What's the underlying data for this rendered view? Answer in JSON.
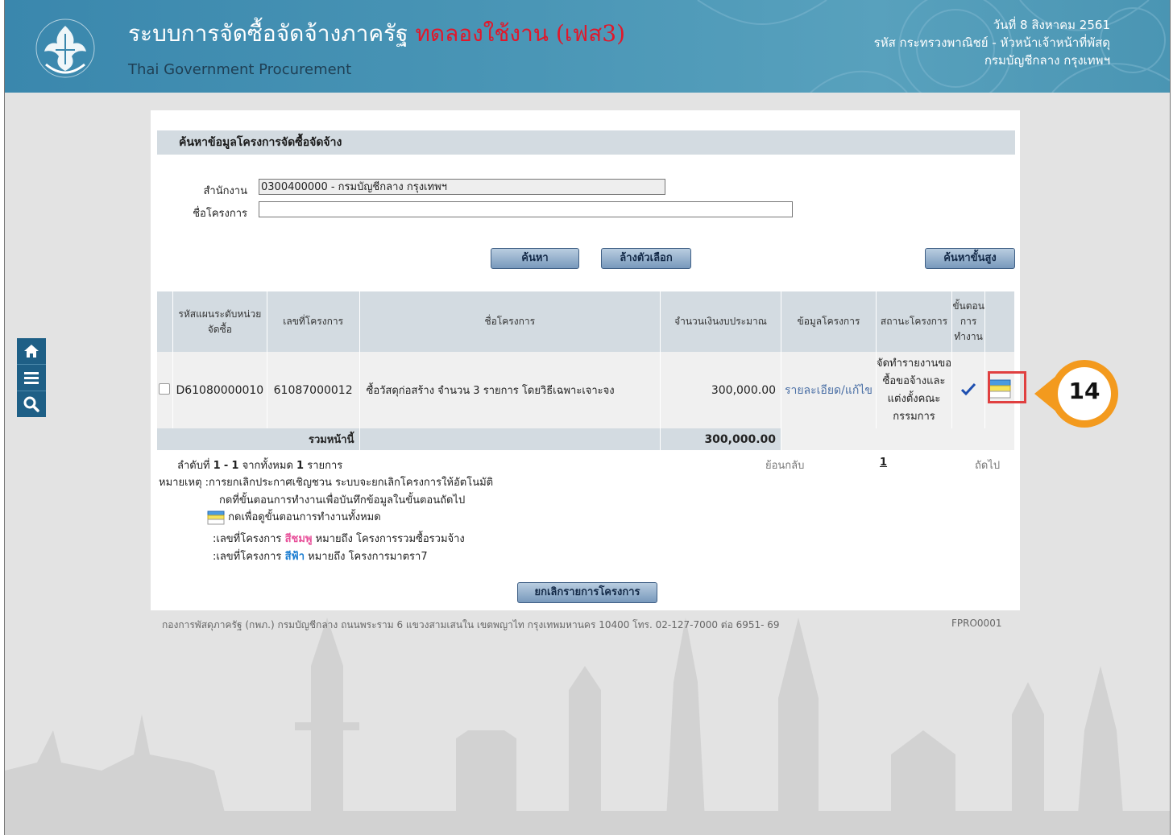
{
  "header": {
    "title": "ระบบการจัดซื้อจัดจ้างภาครัฐ",
    "title_trial": "ทดลองใช้งาน (เฟส3)",
    "subtitle": "Thai Government Procurement",
    "date": "วันที่ 8 สิงหาคม 2561",
    "user_line": "รหัส กระทรวงพาณิชย์ - หัวหน้าเจ้าหน้าที่พัสดุ",
    "org_line": "กรมบัญชีกลาง กรุงเทพฯ",
    "logo_text": "กรมบัญชีกลาง"
  },
  "side_tools": [
    "home-icon",
    "menu-icon",
    "search-icon"
  ],
  "search": {
    "section_title": "ค้นหาข้อมูลโครงการจัดซื้อจัดจ้าง",
    "office_label": "สำนักงาน",
    "office_value": "0300400000 - กรมบัญชีกลาง กรุงเทพฯ",
    "project_name_label": "ชื่อโครงการ",
    "project_name_value": "",
    "search_button": "ค้นหา",
    "clear_button": "ล้างตัวเลือก",
    "advanced_button": "ค้นหาขั้นสูง"
  },
  "table": {
    "headers": {
      "plan_code": "รหัสแผนระดับหน่วยจัดซื้อ",
      "project_no": "เลขที่โครงการ",
      "project_name": "ชื่อโครงการ",
      "budget": "จำนวนเงินงบประมาณ",
      "project_info": "ข้อมูลโครงการ",
      "status": "สถานะโครงการ",
      "step": "ขั้นตอนการทำงาน"
    },
    "rows": [
      {
        "plan_code": "D61080000010",
        "project_no": "61087000012",
        "project_name": "ซื้อวัสดุก่อสร้าง จำนวน 3 รายการ โดยวิธีเฉพาะเจาะจง",
        "budget": "300,000.00",
        "detail_link": "รายละเอียด/แก้ไข",
        "status": "จัดทำรายงานขอซื้อขอจ้างและแต่งตั้งคณะกรรมการ"
      }
    ],
    "sum_label": "รวมหน้านี้",
    "sum_value": "300,000.00"
  },
  "pagination": {
    "summary_prefix": "ลำดับที่",
    "range_from": "1",
    "range_sep": "-",
    "range_to": "1",
    "summary_mid": "จากทั้งหมด",
    "total": "1",
    "summary_suffix": "รายการ",
    "prev": "ย้อนกลับ",
    "page": "1",
    "next": "ถัดไป"
  },
  "notes": {
    "line1": "หมายเหตุ :การยกเลิกประกาศเชิญชวน ระบบจะยกเลิกโครงการให้อัตโนมัติ",
    "line2": "กดที่ขั้นตอนการทำงานเพื่อบันทึกข้อมูลในขั้นตอนถัดไป",
    "line3": "กดเพื่อดูขั้นตอนการทำงานทั้งหมด",
    "line4_prefix": ":เลขที่โครงการ",
    "line4_color": "สีชมพู",
    "line4_suffix": "หมายถึง โครงการรวมซื้อรวมจ้าง",
    "line5_prefix": ":เลขที่โครงการ",
    "line5_color": "สีฟ้า",
    "line5_suffix": "หมายถึง โครงการมาตรา7"
  },
  "cancel_button": "ยกเลิกรายการโครงการ",
  "footer": {
    "address": "กองการพัสดุภาครัฐ (กพภ.) กรมบัญชีกลาง ถนนพระราม 6 แขวงสามเสนใน เขตพญาไท กรุงเทพมหานคร 10400 โทร. 02-127-7000 ต่อ 6951- 69",
    "code": "FPRO0001"
  },
  "callout_number": "14",
  "colors": {
    "header": "#4a96b6",
    "accent_red": "#e0182b",
    "callout_orange": "#f39a1e"
  }
}
